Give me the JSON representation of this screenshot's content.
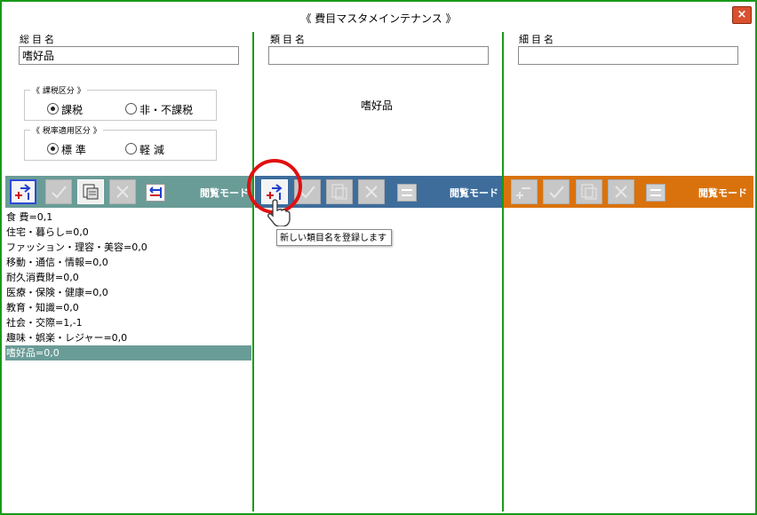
{
  "window": {
    "title": "《 費目マスタメインテナンス 》",
    "close_label": "×"
  },
  "colors": {
    "frame": "#1a9a1a",
    "panel1_toolbar": "#6a9c97",
    "panel2_toolbar": "#3e6d9c",
    "panel3_toolbar": "#d9720c",
    "selection": "#6a9c97",
    "highlight_circle": "#e01010"
  },
  "panel1": {
    "label": "総目名",
    "value": "嗜好品",
    "tax_group": {
      "legend": "《 課税区分 》",
      "options": [
        "課税",
        "非・不課税"
      ],
      "selected": "課税"
    },
    "rate_group": {
      "legend": "《 税率適用区分 》",
      "options": [
        "標 準",
        "軽 減"
      ],
      "selected": "標 準"
    },
    "mode": "閲覧モード",
    "items": [
      "食 費=0,1",
      "住宅・暮らし=0,0",
      "ファッション・理容・美容=0,0",
      "移動・通信・情報=0,0",
      "耐久消費財=0,0",
      "医療・保険・健康=0,0",
      "教育・知識=0,0",
      "社会・交際=1,-1",
      "趣味・娯楽・レジャー=0,0",
      "嗜好品=0,0"
    ],
    "selected_item": "嗜好品=0,0"
  },
  "panel2": {
    "label": "類目名",
    "value": "",
    "parent_name": "嗜好品",
    "mode": "閲覧モード",
    "tooltip": "新しい類目名を登録します"
  },
  "panel3": {
    "label": "細目名",
    "value": "",
    "mode": "閲覧モード"
  },
  "toolbar_icons": [
    "add-record-icon",
    "confirm-check-icon",
    "copy-document-icon",
    "delete-x-icon",
    "switch-mode-icon"
  ]
}
